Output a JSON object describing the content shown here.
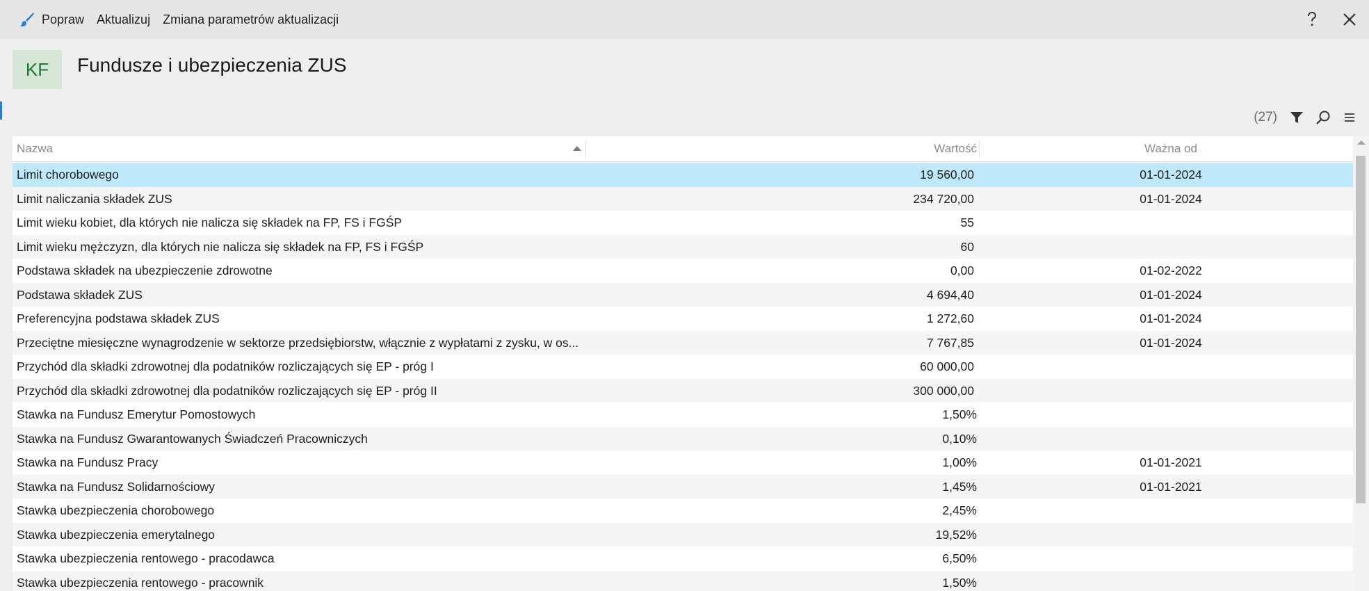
{
  "toolbar": {
    "brush_icon": "brush-icon",
    "fix_label": "Popraw",
    "update_label": "Aktualizuj",
    "change_params_label": "Zmiana parametrów aktualizacji"
  },
  "header": {
    "badge": "KF",
    "title": "Fundusze i ubezpieczenia ZUS"
  },
  "tools": {
    "count": "(27)"
  },
  "table": {
    "columns": {
      "name": "Nazwa",
      "value": "Wartość",
      "valid_from": "Ważna od"
    },
    "rows": [
      {
        "name": "Limit chorobowego",
        "value": "19 560,00",
        "valid_from": "01-01-2024"
      },
      {
        "name": "Limit naliczania składek ZUS",
        "value": "234 720,00",
        "valid_from": "01-01-2024"
      },
      {
        "name": "Limit wieku kobiet, dla których nie nalicza się składek na FP, FS i FGŚP",
        "value": "55",
        "valid_from": ""
      },
      {
        "name": "Limit wieku mężczyzn, dla których nie nalicza się składek na FP, FS i FGŚP",
        "value": "60",
        "valid_from": ""
      },
      {
        "name": "Podstawa składek na ubezpieczenie zdrowotne",
        "value": "0,00",
        "valid_from": "01-02-2022"
      },
      {
        "name": "Podstawa składek ZUS",
        "value": "4 694,40",
        "valid_from": "01-01-2024"
      },
      {
        "name": "Preferencyjna podstawa składek ZUS",
        "value": "1 272,60",
        "valid_from": "01-01-2024"
      },
      {
        "name": "Przeciętne miesięczne wynagrodzenie w sektorze przedsiębiorstw, włącznie z wypłatami z zysku, w os...",
        "value": "7 767,85",
        "valid_from": "01-01-2024"
      },
      {
        "name": "Przychód dla składki zdrowotnej dla podatników rozliczających się EP - próg I",
        "value": "60 000,00",
        "valid_from": ""
      },
      {
        "name": "Przychód dla składki zdrowotnej dla podatników rozliczających się EP - próg II",
        "value": "300 000,00",
        "valid_from": ""
      },
      {
        "name": "Stawka na Fundusz Emerytur Pomostowych",
        "value": "1,50%",
        "valid_from": ""
      },
      {
        "name": "Stawka na Fundusz Gwarantowanych Świadczeń Pracowniczych",
        "value": "0,10%",
        "valid_from": ""
      },
      {
        "name": "Stawka na Fundusz Pracy",
        "value": "1,00%",
        "valid_from": "01-01-2021"
      },
      {
        "name": "Stawka na Fundusz Solidarnościowy",
        "value": "1,45%",
        "valid_from": "01-01-2021"
      },
      {
        "name": "Stawka ubezpieczenia chorobowego",
        "value": "2,45%",
        "valid_from": ""
      },
      {
        "name": "Stawka ubezpieczenia emerytalnego",
        "value": "19,52%",
        "valid_from": ""
      },
      {
        "name": "Stawka ubezpieczenia rentowego - pracodawca",
        "value": "6,50%",
        "valid_from": ""
      },
      {
        "name": "Stawka ubezpieczenia rentowego - pracownik",
        "value": "1,50%",
        "valid_from": ""
      }
    ],
    "selected_index": 0
  },
  "colors": {
    "accent": "#2a7fd0",
    "badge_bg": "#d6e6d6",
    "badge_fg": "#1e7a2e",
    "selected_row": "#bfe9fb"
  }
}
